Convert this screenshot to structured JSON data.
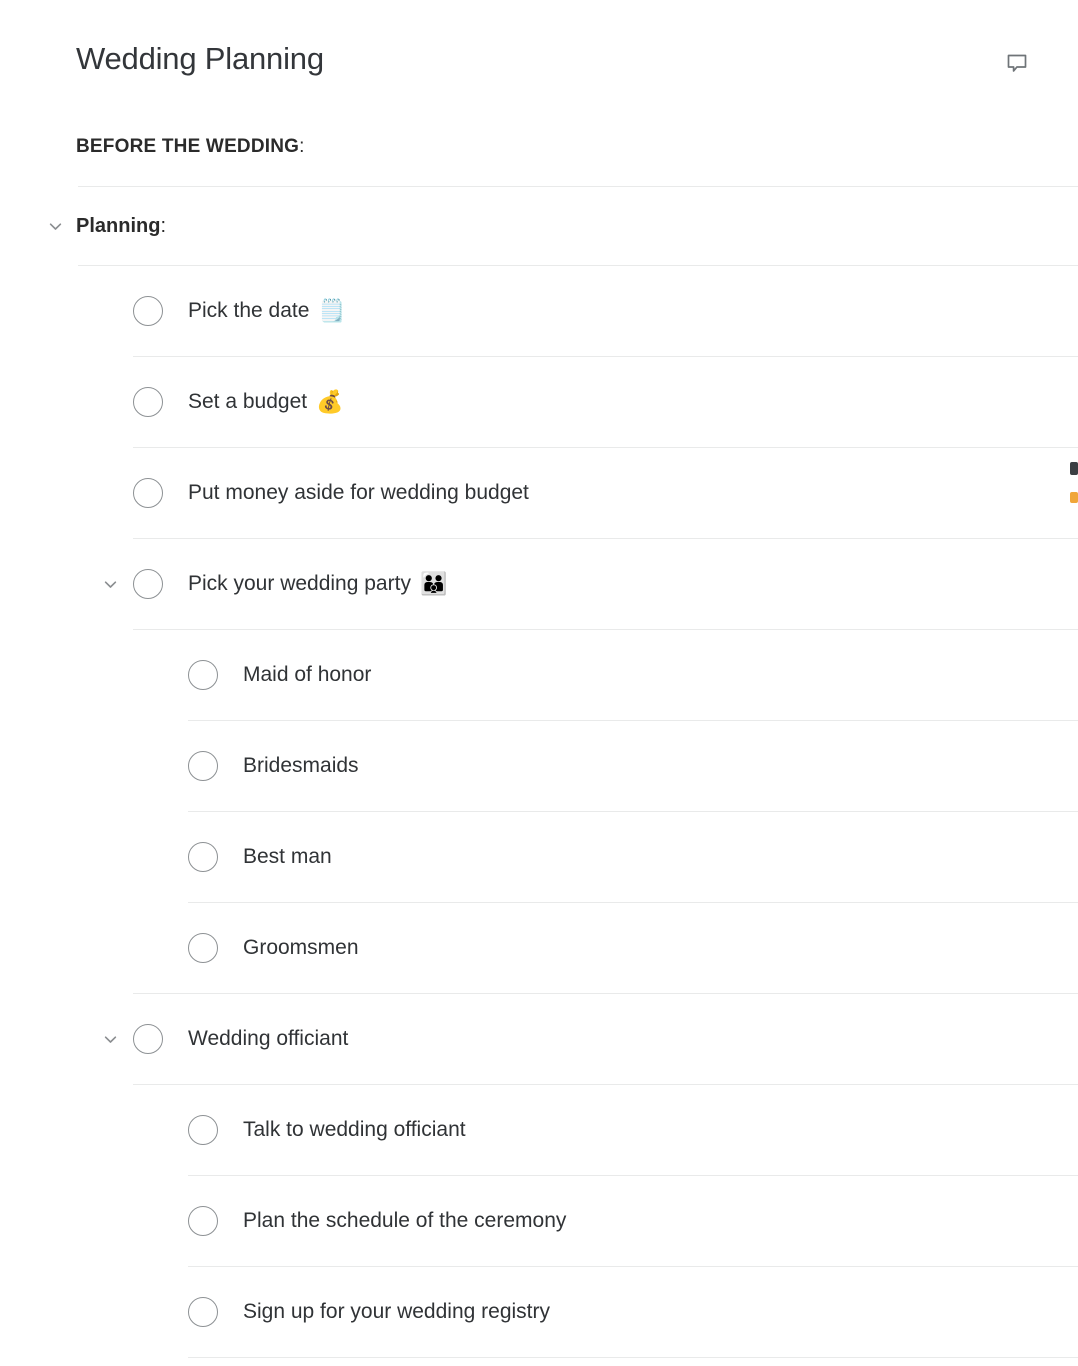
{
  "header": {
    "title": "Wedding Planning",
    "comment_icon": "comment-bubble-icon"
  },
  "section": {
    "label": "BEFORE THE WEDDING",
    "colon": ":"
  },
  "group": {
    "chevron_icon": "chevron-down-icon",
    "label": "Planning",
    "colon": ":",
    "expanded": true
  },
  "colors": {
    "text": "#303336",
    "heading": "#2b2b2b",
    "separator": "#e9eaea",
    "checkbox_border": "#8d9194",
    "chevron": "#8a8d90",
    "icon": "#6f7478",
    "edge_chip_dark": "#3b3f43",
    "edge_chip_amber": "#f0a63a"
  },
  "tasks": [
    {
      "id": "pick-the-date",
      "label": "Pick the date",
      "emoji": "🗒️",
      "emoji_name": "spiral-notepad-emoji",
      "checked": false,
      "level": 1,
      "has_chevron": false,
      "edge_icons": false
    },
    {
      "id": "set-a-budget",
      "label": "Set a budget",
      "emoji": "💰",
      "emoji_name": "money-bag-emoji",
      "checked": false,
      "level": 1,
      "has_chevron": false,
      "edge_icons": false
    },
    {
      "id": "put-money-aside-for-wedding-budget",
      "label": "Put money aside for wedding budget",
      "emoji": "",
      "emoji_name": "",
      "checked": false,
      "level": 1,
      "has_chevron": false,
      "edge_icons": true
    },
    {
      "id": "pick-your-wedding-party",
      "label": "Pick your wedding party",
      "emoji": "👪",
      "emoji_name": "family-emoji",
      "checked": false,
      "level": 1,
      "has_chevron": true,
      "expanded": true,
      "edge_icons": false
    },
    {
      "id": "maid-of-honor",
      "label": "Maid of honor",
      "emoji": "",
      "emoji_name": "",
      "checked": false,
      "level": 2,
      "has_chevron": false,
      "edge_icons": false
    },
    {
      "id": "bridesmaids",
      "label": "Bridesmaids",
      "emoji": "",
      "emoji_name": "",
      "checked": false,
      "level": 2,
      "has_chevron": false,
      "edge_icons": false
    },
    {
      "id": "best-man",
      "label": "Best man",
      "emoji": "",
      "emoji_name": "",
      "checked": false,
      "level": 2,
      "has_chevron": false,
      "edge_icons": false
    },
    {
      "id": "groomsmen",
      "label": "Groomsmen",
      "emoji": "",
      "emoji_name": "",
      "checked": false,
      "level": 2,
      "has_chevron": false,
      "edge_icons": false
    },
    {
      "id": "wedding-officiant",
      "label": "Wedding officiant",
      "emoji": "",
      "emoji_name": "",
      "checked": false,
      "level": 1,
      "has_chevron": true,
      "expanded": true,
      "edge_icons": false
    },
    {
      "id": "talk-to-wedding-officiant",
      "label": "Talk to wedding officiant",
      "emoji": "",
      "emoji_name": "",
      "checked": false,
      "level": 2,
      "has_chevron": false,
      "edge_icons": false
    },
    {
      "id": "plan-the-schedule-of-the-ceremony",
      "label": "Plan the schedule of the ceremony",
      "emoji": "",
      "emoji_name": "",
      "checked": false,
      "level": 2,
      "has_chevron": false,
      "edge_icons": false
    },
    {
      "id": "sign-up-for-your-wedding-registry",
      "label": "Sign up for your wedding registry",
      "emoji": "",
      "emoji_name": "",
      "checked": false,
      "level": 2,
      "has_chevron": false,
      "edge_icons": false
    }
  ]
}
